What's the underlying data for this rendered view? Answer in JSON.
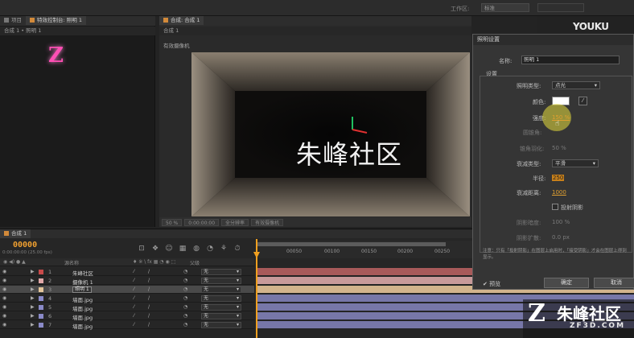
{
  "topbar": {
    "workspace_label": "工作区:",
    "workspace_value": "标准"
  },
  "left_panel": {
    "tabs": [
      "项目",
      "特效控制台: 照明 1"
    ],
    "breadcrumb": "合成 1 • 照明 1",
    "z_mark": "Z"
  },
  "viewer": {
    "tab": "合成: 合成 1",
    "sub_tab": "合成 1",
    "active_camera": "有效摄像机",
    "overlay_text": "朱峰社区",
    "zoom": "50 %",
    "timecode": "0:00:00:00",
    "resolution": "全分辨率",
    "view": "有效摄像机"
  },
  "timeline": {
    "tab": "合成 1",
    "timecode": "00000",
    "timecode_sub": "0:00:00:00 (25.00 fps)",
    "columns": {
      "layer_name": "源名称",
      "parent": "父级"
    },
    "ruler_labels": [
      "00050",
      "00100",
      "00150",
      "00200",
      "00250"
    ],
    "layers": [
      {
        "num": "1",
        "name": "朱峰社区",
        "parent": "无",
        "color": "#c94a4a",
        "bar_color": "#a85a5a"
      },
      {
        "num": "2",
        "name": "摄像机 1",
        "parent": "无",
        "color": "#e0a8a8",
        "bar_color": "#c89a9a"
      },
      {
        "num": "3",
        "name": "照明 1",
        "parent": "无",
        "color": "#e3c59a",
        "bar_color": "#d2b48c"
      },
      {
        "num": "4",
        "name": "墙面.jpg",
        "parent": "无",
        "color": "#8a8ac8",
        "bar_color": "#7777a8"
      },
      {
        "num": "5",
        "name": "墙面.jpg",
        "parent": "无",
        "color": "#8a8ac8",
        "bar_color": "#7777a8"
      },
      {
        "num": "6",
        "name": "墙面.jpg",
        "parent": "无",
        "color": "#8a8ac8",
        "bar_color": "#7777a8"
      },
      {
        "num": "7",
        "name": "墙面.jpg",
        "parent": "无",
        "color": "#8a8ac8",
        "bar_color": "#7777a8"
      }
    ]
  },
  "dialog": {
    "title": "照明设置",
    "name_label": "名称:",
    "name_value": "照明 1",
    "settings_label": "设置",
    "type_label": "照明类型:",
    "type_value": "点光",
    "color_label": "颜色:",
    "intensity_label": "强度:",
    "intensity_value": "150 %",
    "cone_angle_label": "圆锥角:",
    "cone_feather_label": "锥角羽化:",
    "cone_feather_value": "50 %",
    "falloff_label": "衰减类型:",
    "falloff_value": "平滑",
    "radius_label": "半径:",
    "radius_value": "250",
    "distance_label": "衰减距离:",
    "distance_value": "1000",
    "cast_shadow_label": "投射阴影",
    "shadow_darkness_label": "阴影暗度:",
    "shadow_darkness_value": "100 %",
    "shadow_diffusion_label": "阴影扩散:",
    "shadow_diffusion_value": "0.0 px",
    "note": "注意：只有「投射阴影」在图层上启用时，「接受阴影」才会在图层上得到显示。",
    "preview_label": "预览",
    "ok_label": "确定",
    "cancel_label": "取消"
  },
  "branding": {
    "youku": "YOUKU",
    "youku_cn": "优酷",
    "logo_cn": "朱峰社区",
    "logo_url": "ZF3D.COM",
    "logo_z": "Z"
  }
}
